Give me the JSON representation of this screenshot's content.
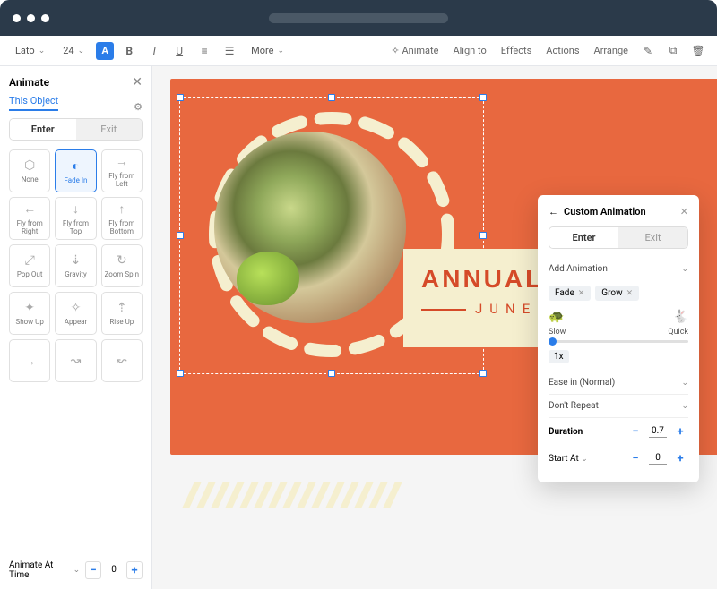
{
  "toolbar": {
    "font": "Lato",
    "size": "24",
    "more": "More",
    "animate": "Animate",
    "align": "Align to",
    "effects": "Effects",
    "actions": "Actions",
    "arrange": "Arrange"
  },
  "panel": {
    "title": "Animate",
    "tab": "This Object",
    "enter": "Enter",
    "exit": "Exit",
    "cells": [
      "None",
      "Fade In",
      "Fly from Left",
      "Fly from Right",
      "Fly from Top",
      "Fly from Bottom",
      "Pop Out",
      "Gravity",
      "Zoom Spin",
      "Show Up",
      "Appear",
      "Rise Up"
    ],
    "timeLabel": "Animate At Time",
    "timeVal": "0"
  },
  "slide": {
    "title": "ANNUAL",
    "sub": "JUNE"
  },
  "popup": {
    "title": "Custom Animation",
    "enter": "Enter",
    "exit": "Exit",
    "add": "Add Animation",
    "chips": [
      "Fade",
      "Grow"
    ],
    "slow": "Slow",
    "quick": "Quick",
    "mult": "1x",
    "ease": "Ease in (Normal)",
    "repeat": "Don't Repeat",
    "duration": "Duration",
    "durVal": "0.7",
    "start": "Start At",
    "startVal": "0"
  }
}
